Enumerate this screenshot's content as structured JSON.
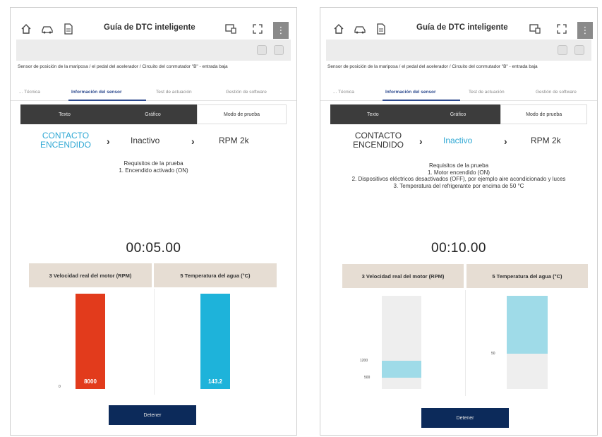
{
  "header": {
    "title": "Guía de DTC inteligente"
  },
  "dtc": {
    "description": "Sensor de posición de la mariposa / el pedal del acelerador / Circuito del conmutador \"B\" - entrada baja"
  },
  "tabs": [
    {
      "label": "... Técnica"
    },
    {
      "label": "Información del sensor"
    },
    {
      "label": "Test de actuación"
    },
    {
      "label": "Gestión de software"
    }
  ],
  "segments": [
    {
      "label": "Texto"
    },
    {
      "label": "Gráfico"
    },
    {
      "label": "Modo de prueba"
    }
  ],
  "left_panel": {
    "steps": [
      "CONTACTO ENCENDIDO",
      "Inactivo",
      "RPM 2k"
    ],
    "requirements_title": "Requisitos de la prueba",
    "requirements": [
      "1. Encendido activado (ON)"
    ],
    "timer": "00:05.00",
    "chart_left_title": "3 Velocidad real del motor (RPM)",
    "chart_right_title": "5 Temperatura del agua (°C)",
    "tick_left": "0",
    "rpm_value": "8000",
    "water_value": "143.2",
    "rpm_fill": 1.0,
    "water_fill": 1.0,
    "stop_label": "Detener"
  },
  "right_panel": {
    "steps": [
      "CONTACTO ENCENDIDO",
      "Inactivo",
      "RPM 2k"
    ],
    "requirements_title": "Requisitos de la prueba",
    "requirements": [
      "1. Motor encendido (ON)",
      "2. Dispositivos eléctricos desactivados (OFF), por ejemplo aire acondicionado y luces",
      "3. Temperatura del refrigerante por encima de 50 °C"
    ],
    "timer": "00:10.00",
    "chart_left_title": "3 Velocidad real del motor (RPM)",
    "chart_right_title": "5 Temperatura del agua (°C)",
    "tick_left_high": "1200",
    "tick_left_low": "500",
    "tick_right": "50",
    "rpm_band_low": 0.12,
    "rpm_band_high": 0.3,
    "water_fill": 0.8,
    "water_marker": 0.38,
    "stop_label": "Detener"
  },
  "colors": {
    "accent_active_step": "#2fa8d4",
    "bar_rpm_left": "#e23b1c",
    "bar_water_left": "#1eb3da",
    "bar_band_right": "#9fdbe8",
    "stop_button": "#0c2a5a"
  },
  "icons": [
    "home-icon",
    "car-icon",
    "document-icon",
    "display-icon",
    "expand-icon",
    "more-icon"
  ]
}
